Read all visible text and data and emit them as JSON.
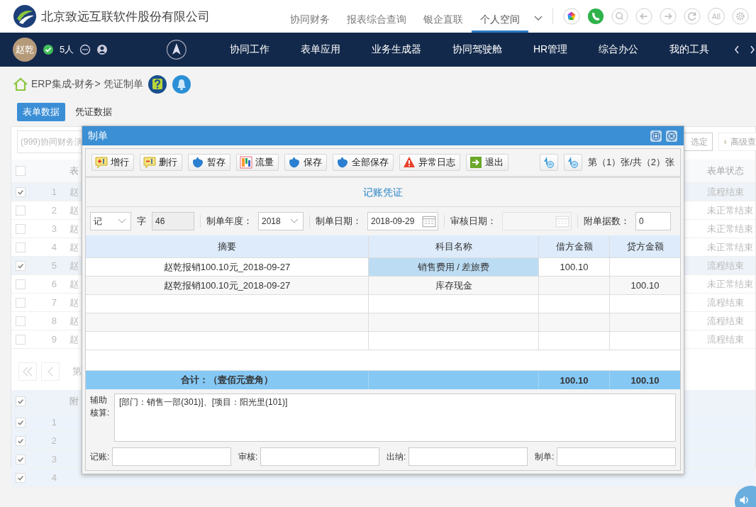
{
  "header": {
    "company": "北京致远互联软件股份有限公司",
    "menu": [
      {
        "label": "协同财务",
        "selected": false
      },
      {
        "label": "报表综合查询",
        "selected": false
      },
      {
        "label": "银企直联",
        "selected": false
      },
      {
        "label": "个人空间",
        "selected": true
      }
    ],
    "a8": "A8"
  },
  "navbar": {
    "avatar": "赵乾",
    "online": "5人",
    "items": [
      "协同工作",
      "表单应用",
      "业务生成器",
      "协同驾驶舱",
      "HR管理",
      "综合办公",
      "我的工具"
    ]
  },
  "breadcrumb": {
    "path": "ERP集成-财务>",
    "current": "凭证制单"
  },
  "tabs": [
    {
      "label": "表单数据",
      "selected": true
    },
    {
      "label": "凭证数据",
      "selected": false
    }
  ],
  "list": {
    "search_placeholder": "(999)协同财务演",
    "select_button": "选定",
    "query_button": "高级查",
    "name_column": "表",
    "status_column": "表单状态",
    "all_checked": false,
    "rows": [
      {
        "index": "1",
        "name": "赵",
        "status": "流程结束",
        "checked": true
      },
      {
        "index": "2",
        "name": "赵",
        "status": "未正常结束",
        "checked": false
      },
      {
        "index": "3",
        "name": "赵",
        "status": "未正常结束",
        "checked": false
      },
      {
        "index": "4",
        "name": "赵",
        "status": "未正常结束",
        "checked": false
      },
      {
        "index": "5",
        "name": "赵",
        "status": "流程结束",
        "checked": true
      },
      {
        "index": "6",
        "name": "赵",
        "status": "未正常结束",
        "checked": false
      },
      {
        "index": "7",
        "name": "赵",
        "status": "流程结束",
        "checked": false
      },
      {
        "index": "8",
        "name": "赵",
        "status": "流程结束",
        "checked": false
      },
      {
        "index": "9",
        "name": "赵",
        "status": "流程结束",
        "checked": false
      }
    ],
    "pager": "第"
  },
  "sub_list": {
    "column": "附",
    "all_checked": true,
    "rows": [
      {
        "index": "1",
        "checked": true
      },
      {
        "index": "2",
        "checked": true
      },
      {
        "index": "3",
        "checked": true
      },
      {
        "index": "4",
        "checked": true
      }
    ]
  },
  "dialog": {
    "title": "制单",
    "toolbar": [
      {
        "label": "增行",
        "kind": "add"
      },
      {
        "label": "删行",
        "kind": "remove"
      },
      {
        "label": "暂存",
        "kind": "hand"
      },
      {
        "label": "流量",
        "kind": "flow"
      },
      {
        "label": "保存",
        "kind": "hand"
      },
      {
        "label": "全部保存",
        "kind": "hand"
      },
      {
        "label": "异常日志",
        "kind": "warning"
      },
      {
        "label": "退出",
        "kind": "exit"
      }
    ],
    "pager": "第（1）张/共（2）张",
    "voucher_title": "记账凭证",
    "form": {
      "type": "记",
      "word_label": "字",
      "number": "46",
      "year_label": "制单年度：",
      "year": "2018",
      "date_label": "制单日期：",
      "date": "2018-09-29",
      "audit_date_label": "审核日期：",
      "attachments_label": "附单据数：",
      "attachments": "0"
    },
    "columns": [
      "摘要",
      "科目名称",
      "借方金额",
      "贷方金额"
    ],
    "rows": [
      {
        "summary": "赵乾报销100.10元_2018-09-27",
        "account": "销售费用 / 差旅费",
        "debit": "100.10",
        "selected": true
      },
      {
        "summary": "赵乾报销100.10元_2018-09-27",
        "account": "库存现金",
        "credit": "100.10",
        "selected": false
      }
    ],
    "total": {
      "label": "合计：（壹佰元壹角）",
      "debit": "100.10",
      "credit": "100.10"
    },
    "aux_label": "辅助核算:",
    "aux_value": "[部门：销售一部(301)]、[项目：阳光里(101)]",
    "signatures": [
      "记账:",
      "审核:",
      "出纳:",
      "制单:"
    ]
  }
}
